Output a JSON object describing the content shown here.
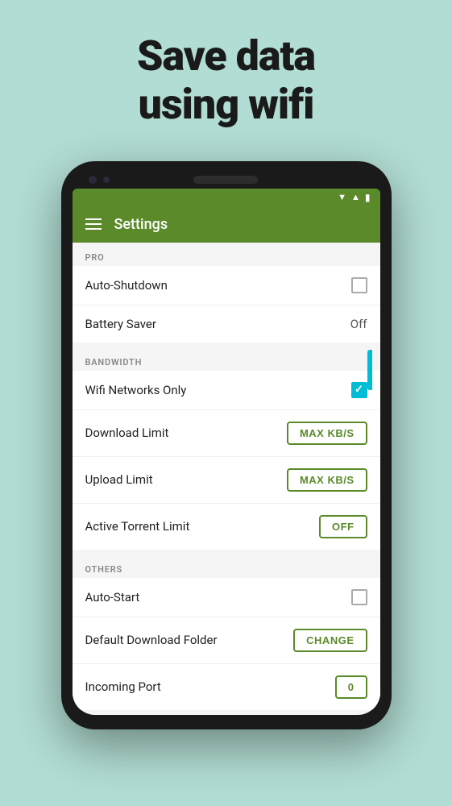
{
  "header": {
    "title": "Save data\nusing wifi"
  },
  "appBar": {
    "title": "Settings",
    "menuIcon": "hamburger"
  },
  "sections": {
    "pro": {
      "label": "PRO",
      "items": [
        {
          "id": "auto-shutdown",
          "label": "Auto-Shutdown",
          "control": "checkbox",
          "value": false
        },
        {
          "id": "battery-saver",
          "label": "Battery Saver",
          "control": "text",
          "value": "Off"
        }
      ]
    },
    "bandwidth": {
      "label": "BANDWIDTH",
      "items": [
        {
          "id": "wifi-networks-only",
          "label": "Wifi Networks Only",
          "control": "checkbox",
          "value": true
        },
        {
          "id": "download-limit",
          "label": "Download Limit",
          "control": "button",
          "value": "MAX KB/S"
        },
        {
          "id": "upload-limit",
          "label": "Upload Limit",
          "control": "button",
          "value": "MAX KB/S"
        },
        {
          "id": "active-torrent-limit",
          "label": "Active Torrent Limit",
          "control": "button",
          "value": "OFF"
        }
      ]
    },
    "others": {
      "label": "OTHERS",
      "items": [
        {
          "id": "auto-start",
          "label": "Auto-Start",
          "control": "checkbox",
          "value": false
        },
        {
          "id": "default-download-folder",
          "label": "Default Download Folder",
          "control": "button",
          "value": "CHANGE"
        },
        {
          "id": "incoming-port",
          "label": "Incoming Port",
          "control": "button",
          "value": "0"
        }
      ]
    }
  },
  "statusBar": {
    "wifi": "▼",
    "signal": "▲",
    "battery": "▮"
  }
}
